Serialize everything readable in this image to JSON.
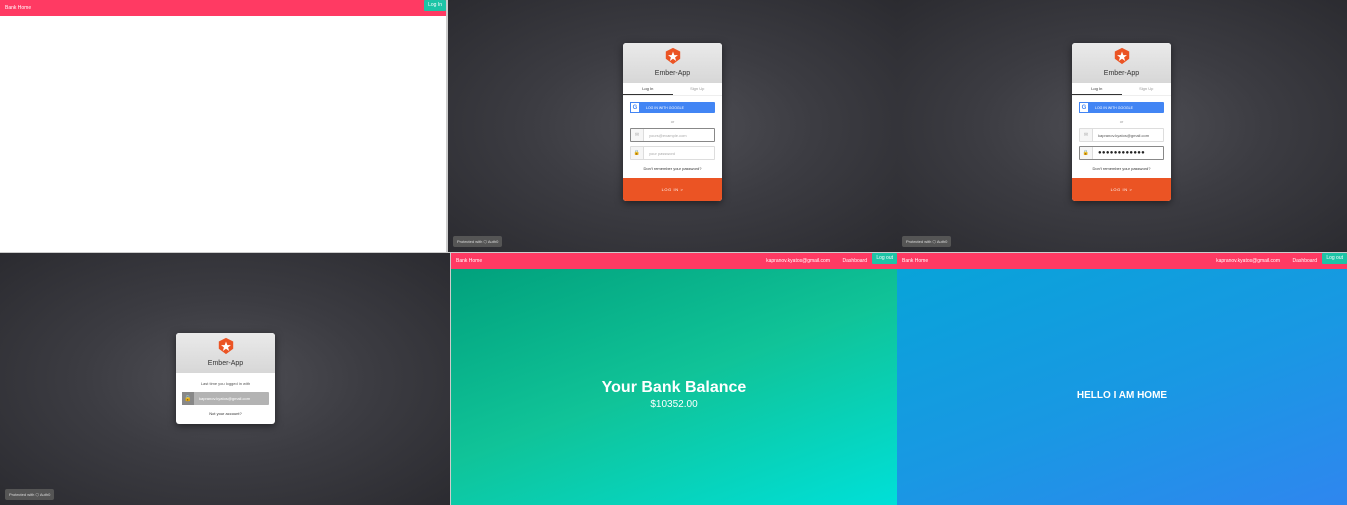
{
  "brand": "Bank Home",
  "colors": {
    "navbar": "#ff3a63",
    "button": "#1dc4a6",
    "submit": "#eb5424",
    "google": "#4285f4"
  },
  "panel1": {
    "login_button": "Log In"
  },
  "lock": {
    "app_name": "Ember-App",
    "tab_login": "Log In",
    "tab_signup": "Sign Up",
    "google_button": "LOG IN WITH GOOGLE",
    "or_text": "or",
    "email_placeholder": "yours@example.com",
    "password_placeholder": "your password",
    "forgot": "Don't remember your password?",
    "submit": "LOG IN >",
    "protected_by": "Protected with",
    "auth0": "Auth0",
    "email_icon": "envelope-icon",
    "password_icon": "lock-icon"
  },
  "filled": {
    "email_value": "kapranov.kyatos@gmail.com",
    "password_dots": "●●●●●●●●●●●●"
  },
  "last": {
    "last_time": "Last time you logged in with",
    "account": "kapranov.kyatos@gmail.com",
    "not_your": "Not your account?"
  },
  "logged_in": {
    "email": "kapranov.kyatos@gmail.com",
    "dashboard": "Dashboard",
    "logout": "Log out"
  },
  "balance": {
    "title": "Your Bank Balance",
    "amount": "$10352.00"
  },
  "home": {
    "title": "HELLO I AM HOME"
  }
}
